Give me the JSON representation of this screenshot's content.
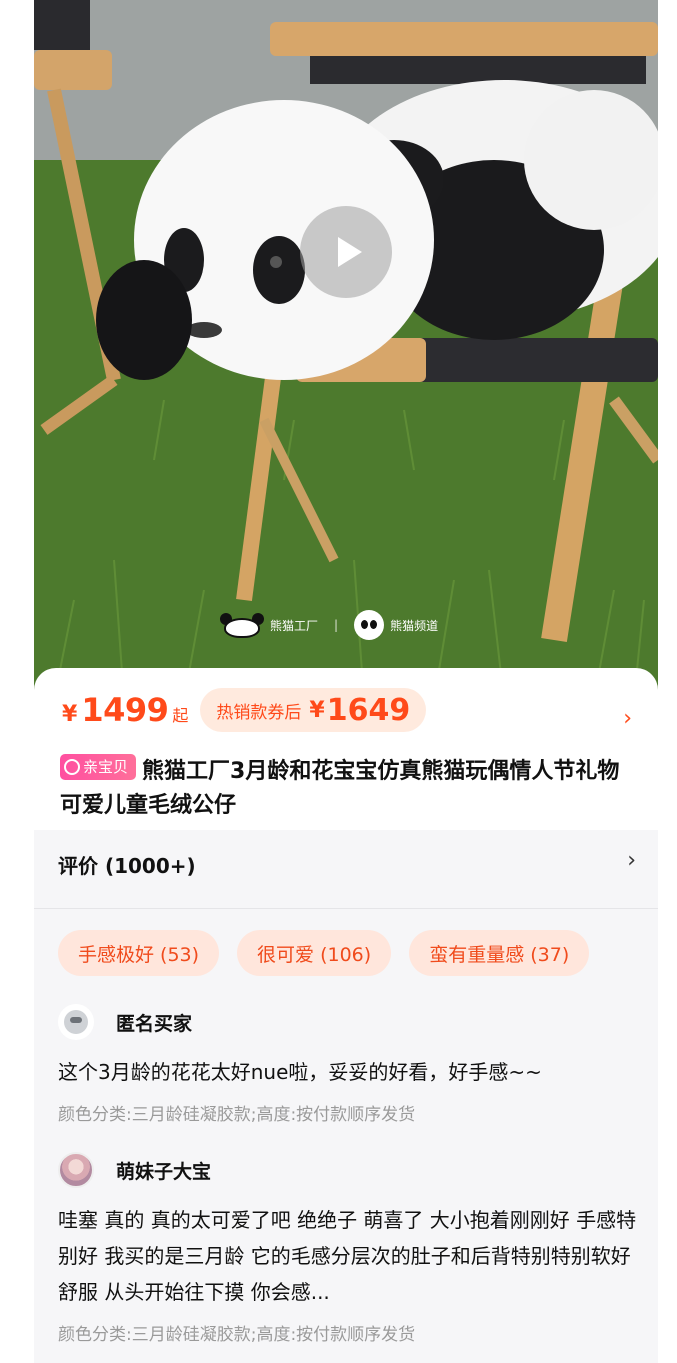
{
  "hero": {
    "play_icon": "play-icon",
    "watermark_left": "熊猫工厂",
    "watermark_sep": "|",
    "watermark_right": "熊猫频道"
  },
  "price": {
    "currency": "¥",
    "amount": "1499",
    "suffix": "起",
    "coupon_label": "热销款券后",
    "coupon_currency": "¥",
    "coupon_amount": "1649",
    "chevron": "›"
  },
  "product": {
    "badge": "亲宝贝",
    "title": "熊猫工厂3月龄和花宝宝仿真熊猫玩偶情人节礼物可爱儿童毛绒公仔"
  },
  "reviews": {
    "header": "评价 (1000+)",
    "chevron": "›",
    "tags": [
      "手感极好 (53)",
      "很可爱 (106)",
      "蛮有重量感 (37)"
    ],
    "items": [
      {
        "user": "匿名买家",
        "text": "这个3月龄的花花太好nue啦，妥妥的好看，好手感~~",
        "meta": "颜色分类:三月龄硅凝胶款;高度:按付款顺序发货"
      },
      {
        "user": "萌妹子大宝",
        "text": "哇塞 真的 真的太可爱了吧 绝绝子 萌喜了 大小抱着刚刚好 手感特别好 我买的是三月龄 它的毛感分层次的肚子和后背特别特别软好舒服 从头开始往下摸 你会感...",
        "meta": "颜色分类:三月龄硅凝胶款;高度:按付款顺序发货"
      }
    ]
  }
}
